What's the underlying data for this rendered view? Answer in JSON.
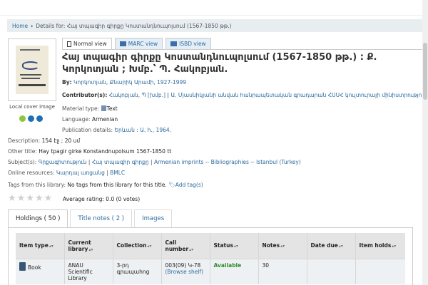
{
  "breadcrumb": {
    "home": "Home",
    "details": "Details for: Հայ տպագիր գիրքը Կոստանդնուպոլսում (1567-1850 թթ.)"
  },
  "cover": {
    "label": "Local cover image",
    "dot_colors": [
      "#8cc63f",
      "#1f6fb5",
      "#1f6fb5"
    ]
  },
  "view_tabs": {
    "normal": "Normal view",
    "marc": "MARC view",
    "isbd": "ISBD view"
  },
  "record": {
    "title": "Հայ տպագիր գիրքը Կոստանդնուպոլսում (1567-1850 թթ.) : Ք. Կորկոտյան ; Խմբ.՝ Պ. Հակոբյան.",
    "by_label": "By:",
    "by_value": "Կորկոտյան, Քնարիկ Արամի, 1927-1999",
    "contrib_label": "Contributor(s):",
    "contrib_1": "Հակոբյան, Պ [խմբ.]",
    "contrib_2": "Ա. Մյասնիկյանի անվան հանրապետական գրադարան ՀՍՍՀ կուլտուրայի մինիստրություն",
    "material_label": "Material type:",
    "material_value": "Text",
    "language_label": "Language:",
    "language_value": "Armenian",
    "pub_label": "Publication details:",
    "pub_value": "Երևան : Ա. հ., 1964.",
    "description_label": "Description:",
    "description_value": "154 էջ ; 20 սմ",
    "other_title_label": "Other title:",
    "other_title_value": "Hay tpagir girke Konstandnupolsum 1567-1850 tt",
    "subjects_label": "Subject(s):",
    "subject_1": "Գրքագիտություն",
    "subject_2": "Հայ տպագիր գիրքը",
    "subject_3": "Armenian imprints -- Bibliographies -- Istanbul (Turkey)",
    "online_label": "Online resources:",
    "online_1": "Կարդալ առցանց",
    "online_2": "BMLC",
    "tags_label": "Tags from this library:",
    "tags_value": "No tags from this library for this title.",
    "add_tags": "Add tag(s)",
    "rating": "Average rating: 0.0 (0 votes)"
  },
  "holdings_tabs": {
    "holdings": "Holdings ( 50 )",
    "title_notes": "Title notes ( 2 )",
    "images": "Images"
  },
  "table": {
    "headers": [
      "Item type",
      "Current library",
      "Collection",
      "Call number",
      "Status",
      "Notes",
      "Date due",
      "Item holds"
    ],
    "row": {
      "item_type": "Book",
      "library": "ANAU Scientific Library",
      "collection": "3-րդ գրապահոց",
      "call_number": "003(09) Կ-78",
      "browse": "(Browse shelf)",
      "status": "Available",
      "notes": "30",
      "date_due": "",
      "item_holds": ""
    }
  }
}
